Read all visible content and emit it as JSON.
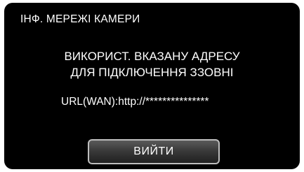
{
  "screen": {
    "title": "ІНФ. МЕРЕЖІ КАМЕРИ",
    "message_line1": "ВИКОРИСТ. ВКАЗАНУ АДРЕСУ",
    "message_line2": "ДЛЯ ПІДКЛЮЧЕННЯ ЗЗОВНІ",
    "url_text": "URL(WAN):http://***************",
    "exit_label": "ВИЙТИ"
  },
  "colors": {
    "background": "#000000",
    "text": "#ffffff",
    "button_border": "#bdbdbd"
  }
}
